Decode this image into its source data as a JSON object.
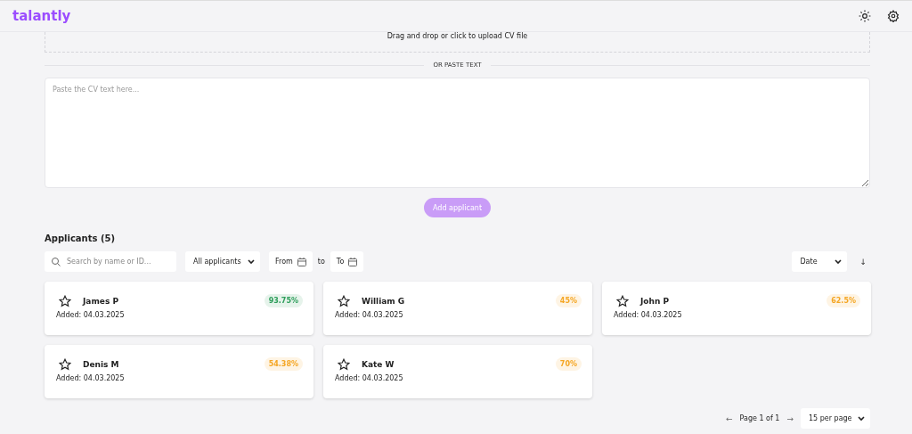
{
  "header": {
    "logo": "talantly"
  },
  "upload": {
    "hint": "Drag and drop or click to upload CV file"
  },
  "divider": "OR PASTE TEXT",
  "cv_text": {
    "placeholder": "Paste the CV text here..."
  },
  "add_button": {
    "label": "Add applicant",
    "disabled": true
  },
  "applicants": {
    "title": "Applicants (5)",
    "search": {
      "placeholder": "Search by name or ID..."
    },
    "filter": "All applicants",
    "from": "From",
    "to_word": "to",
    "to": "To",
    "sort": "Date",
    "sort_direction": "↓",
    "cards": [
      {
        "name": "James P",
        "starred": false,
        "score": "93.75%",
        "color": "#2e9e5b",
        "added": "Added: 04.03.2025"
      },
      {
        "name": "William G",
        "starred": false,
        "score": "45%",
        "color": "#f5a623",
        "added": "Added: 04.03.2025"
      },
      {
        "name": "John P",
        "starred": false,
        "score": "62.5%",
        "color": "#f5a623",
        "added": "Added: 04.03.2025"
      },
      {
        "name": "Denis M",
        "starred": false,
        "score": "54.38%",
        "color": "#f5a623",
        "added": "Added: 04.03.2025"
      },
      {
        "name": "Kate W",
        "starred": false,
        "score": "70%",
        "color": "#f5a623",
        "added": "Added: 04.03.2025"
      }
    ],
    "pagination": {
      "prev": "←",
      "page": "Page 1 of 1",
      "next": "→",
      "per_page": "15 per page"
    }
  }
}
